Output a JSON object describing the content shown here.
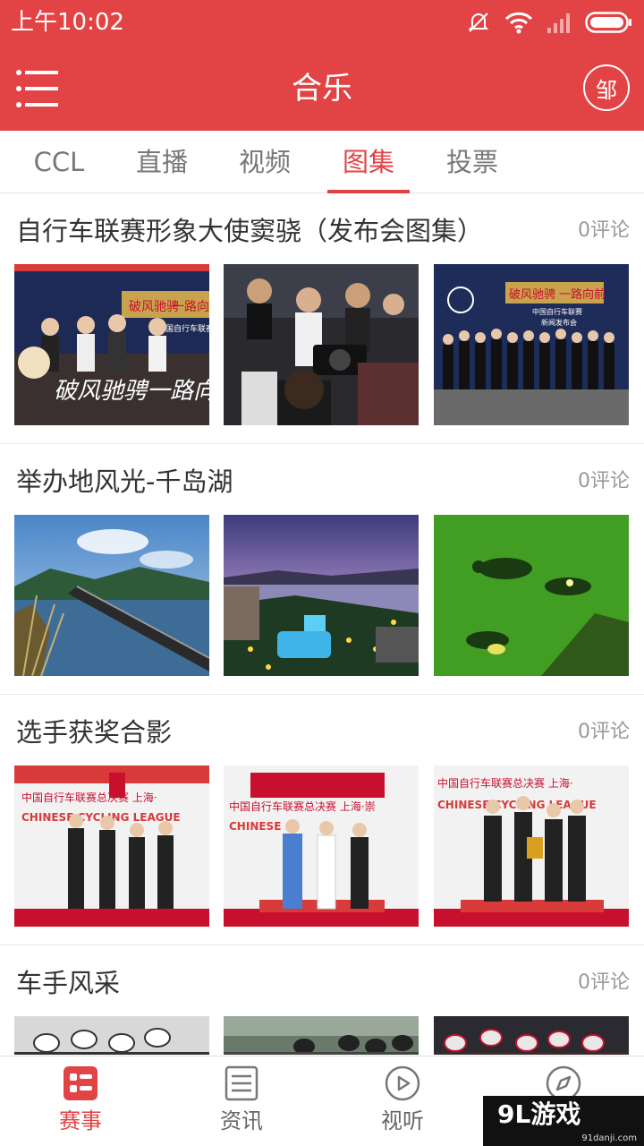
{
  "status_bar": {
    "time": "上午10:02"
  },
  "header": {
    "title": "合乐",
    "badge_text": "邹"
  },
  "tabs": [
    {
      "label": "CCL",
      "active": false
    },
    {
      "label": "直播",
      "active": false
    },
    {
      "label": "视频",
      "active": false
    },
    {
      "label": "图集",
      "active": true
    },
    {
      "label": "投票",
      "active": false
    }
  ],
  "galleries": [
    {
      "title": "自行车联赛形象大使窦骁（发布会图集）",
      "comments": "0评论",
      "photo_text": [
        "破风驰骋",
        "一路向前",
        "中国自行车联赛",
        "破风驰骋一路向前",
        "破风驰骋",
        "一路向前",
        "中国自行车联赛",
        "新闻发布会"
      ]
    },
    {
      "title": "举办地风光-千岛湖",
      "comments": "0评论"
    },
    {
      "title": "选手获奖合影",
      "comments": "0评论",
      "photo_text": [
        "中国自行车联赛总决赛 上海·",
        "CHINESE CYCLING LEAGUE",
        "中国自行车联赛总决赛 上海·崇",
        "CHINESE",
        "中国自行车联赛总决赛 上海·",
        "CHINESE CYCLING LEAGUE"
      ]
    },
    {
      "title": "车手风采",
      "comments": "0评论"
    }
  ],
  "bottom_nav": [
    {
      "label": "赛事",
      "icon": "events-icon",
      "active": true
    },
    {
      "label": "资讯",
      "icon": "news-icon",
      "active": false
    },
    {
      "label": "视听",
      "icon": "play-icon",
      "active": false
    },
    {
      "label": "",
      "icon": "compass-icon",
      "active": false
    }
  ],
  "watermark": {
    "main": "9L游戏",
    "sub": "91danji.com"
  },
  "colors": {
    "brand_red": "#e24345",
    "text_dark": "#333333",
    "text_muted": "#999999"
  }
}
